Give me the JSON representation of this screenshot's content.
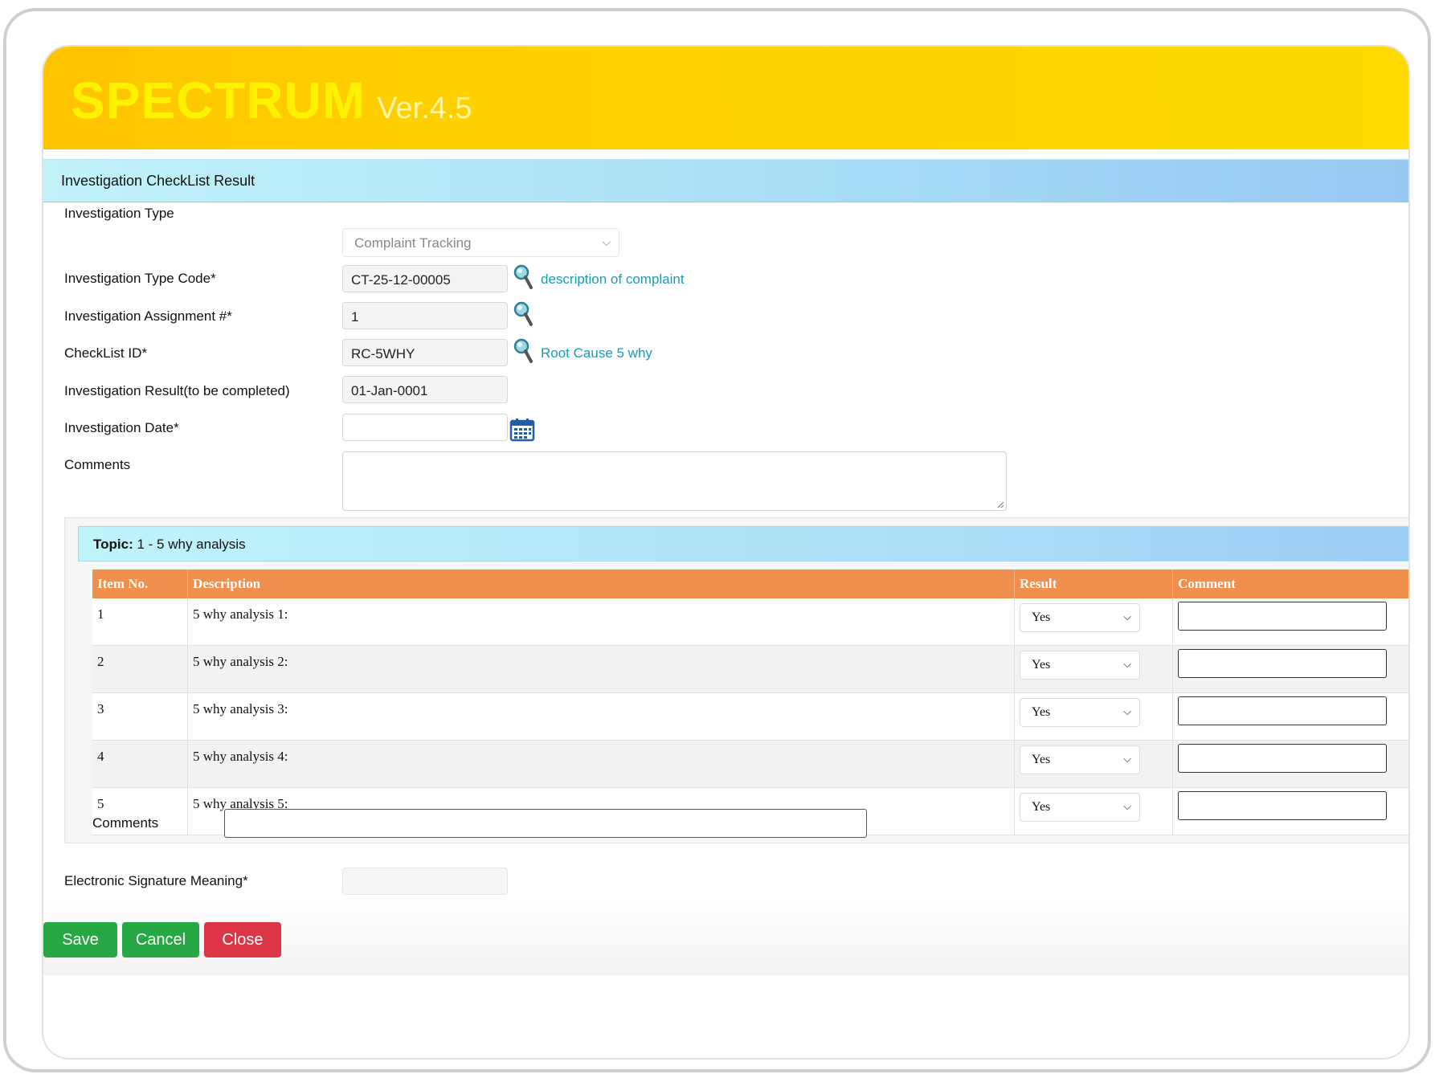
{
  "app": {
    "brand": "SPECTRUM",
    "version": "Ver.4.5"
  },
  "section": {
    "title": "Investigation CheckList Result"
  },
  "form": {
    "investigation_type_label": "Investigation Type",
    "investigation_type_value": "Complaint Tracking",
    "type_code_label": "Investigation Type Code*",
    "type_code_value": "CT-25-12-00005",
    "type_code_link": "description of complaint",
    "assignment_label": "Investigation Assignment #*",
    "assignment_value": "1",
    "checklist_label": "CheckList ID*",
    "checklist_value": "RC-5WHY",
    "checklist_link": "Root Cause 5 why",
    "result_label": "Investigation Result(to be completed)",
    "result_value": "01-Jan-0001",
    "date_label": "Investigation Date*",
    "date_value": "",
    "comments_label": "Comments"
  },
  "topic": {
    "prefix": "Topic:",
    "title": "1 - 5 why analysis",
    "columns": [
      "Item No.",
      "Description",
      "Result",
      "Comment"
    ],
    "rows": [
      {
        "no": "1",
        "desc": "5 why analysis 1:",
        "result": "Yes"
      },
      {
        "no": "2",
        "desc": "5 why analysis 2:",
        "result": "Yes"
      },
      {
        "no": "3",
        "desc": "5 why analysis 3:",
        "result": "Yes"
      },
      {
        "no": "4",
        "desc": "5 why analysis 4:",
        "result": "Yes"
      },
      {
        "no": "5",
        "desc": "5 why analysis 5:",
        "result": "Yes"
      }
    ],
    "comments_label": "Comments"
  },
  "esig": {
    "label": "Electronic Signature Meaning*"
  },
  "buttons": {
    "save": "Save",
    "cancel": "Cancel",
    "close": "Close"
  },
  "colors": {
    "banner": "#ffd000",
    "header_orange": "#f0904c",
    "save_green": "#28a745",
    "close_red": "#dc3545",
    "link": "#1a9bb8"
  },
  "icons": {
    "lookup": "magnifier-icon",
    "calendar": "calendar-icon",
    "dropdown": "chevron-down-icon"
  }
}
